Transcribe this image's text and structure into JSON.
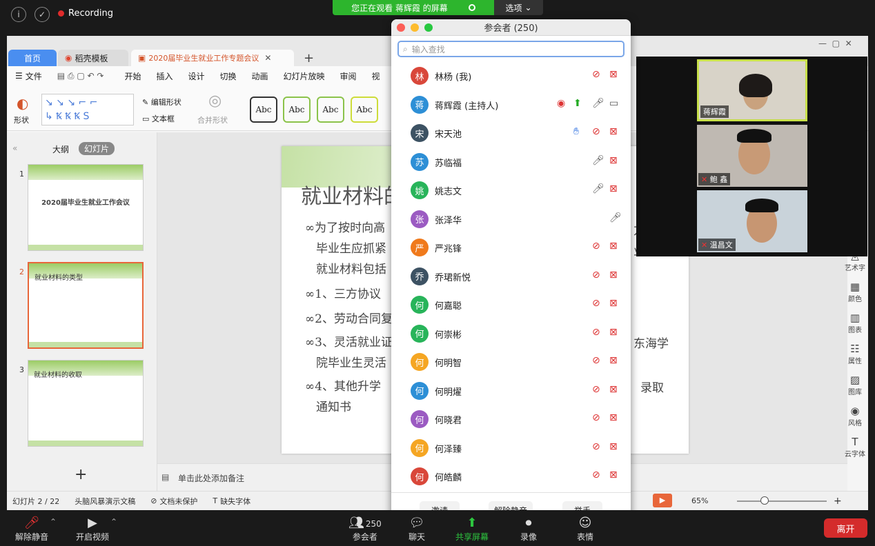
{
  "topbar": {
    "recording": "Recording",
    "viewing": "您正在观看 蒋辉霞 的屏幕",
    "options": "选项"
  },
  "wps": {
    "tabs": {
      "home": "首页",
      "template": "稻壳模板",
      "doc": "2020届毕业生就业工作专题会议"
    },
    "menu": [
      "文件",
      "开始",
      "插入",
      "设计",
      "切换",
      "动画",
      "幻灯片放映",
      "审阅",
      "视"
    ],
    "ribbon": {
      "shape": "形状",
      "edit_shape": "编辑形状",
      "textbox": "文本框",
      "merge": "合并形状",
      "abc": "Abc"
    },
    "panel": {
      "outline": "大纲",
      "slides": "幻灯片"
    },
    "thumbs": [
      {
        "num": "1",
        "title": "2020届毕业生就业工作会议"
      },
      {
        "num": "2",
        "title": "就业材料的类型"
      },
      {
        "num": "3",
        "title": "就业材料的收取"
      }
    ],
    "slide": {
      "title": "就业材料的",
      "lines": [
        "∞为了按时向高",
        "毕业生应抓紧",
        "就业材料包括",
        "∞1、三方协议",
        "∞2、劳动合同复",
        "∞3、灵活就业证",
        "院毕业生灵活",
        "∞4、其他升学",
        "通知书"
      ],
      "right_fragments": [
        "方",
        "业",
        "东海学",
        "录取"
      ]
    },
    "notes": "单击此处添加备注",
    "rightbar": [
      "艺术字",
      "颜色",
      "图表",
      "属性",
      "图库",
      "风格",
      "云字体"
    ],
    "status": {
      "slide": "幻灯片 2 / 22",
      "theme": "头脑风暴演示文稿",
      "protect": "文档未保护",
      "font": "缺失字体",
      "zoom": "65%"
    }
  },
  "videos": [
    {
      "name": "蒋辉霞"
    },
    {
      "name": "鲍 鑫"
    },
    {
      "name": "温昌文"
    }
  ],
  "participants": {
    "title": "参会者 (250)",
    "search_placeholder": "输入查找",
    "list": [
      {
        "initial": "林",
        "name": "林杨 (我)",
        "color": "#d9473a"
      },
      {
        "initial": "蒋",
        "name": "蒋辉霞 (主持人)",
        "color": "#2d8fd6"
      },
      {
        "initial": "宋",
        "name": "宋天池",
        "color": "#3d5263"
      },
      {
        "initial": "苏",
        "name": "苏临福",
        "color": "#2d8fd6"
      },
      {
        "initial": "姚",
        "name": "姚志文",
        "color": "#28b45a"
      },
      {
        "initial": "张",
        "name": "张泽华",
        "color": "#9b5bc2"
      },
      {
        "initial": "严",
        "name": "严兆锋",
        "color": "#f07a1c"
      },
      {
        "initial": "乔",
        "name": "乔珺新悦",
        "color": "#3d5263"
      },
      {
        "initial": "何",
        "name": "何嘉聪",
        "color": "#28b45a"
      },
      {
        "initial": "何",
        "name": "何崇彬",
        "color": "#28b45a"
      },
      {
        "initial": "何",
        "name": "何明智",
        "color": "#f5a623"
      },
      {
        "initial": "何",
        "name": "何明燿",
        "color": "#2d8fd6"
      },
      {
        "initial": "何",
        "name": "何晓君",
        "color": "#9b5bc2"
      },
      {
        "initial": "何",
        "name": "何泽臻",
        "color": "#f5a623"
      },
      {
        "initial": "何",
        "name": "何皓麟",
        "color": "#d9473a"
      }
    ],
    "buttons": {
      "invite": "邀请",
      "unmute_all": "解除静音",
      "raise_hand": "举手"
    }
  },
  "bottombar": {
    "unmute": "解除静音",
    "video": "开启视频",
    "participants": "参会者",
    "count": "250",
    "chat": "聊天",
    "share": "共享屏幕",
    "record": "录像",
    "reactions": "表情",
    "leave": "离开"
  }
}
